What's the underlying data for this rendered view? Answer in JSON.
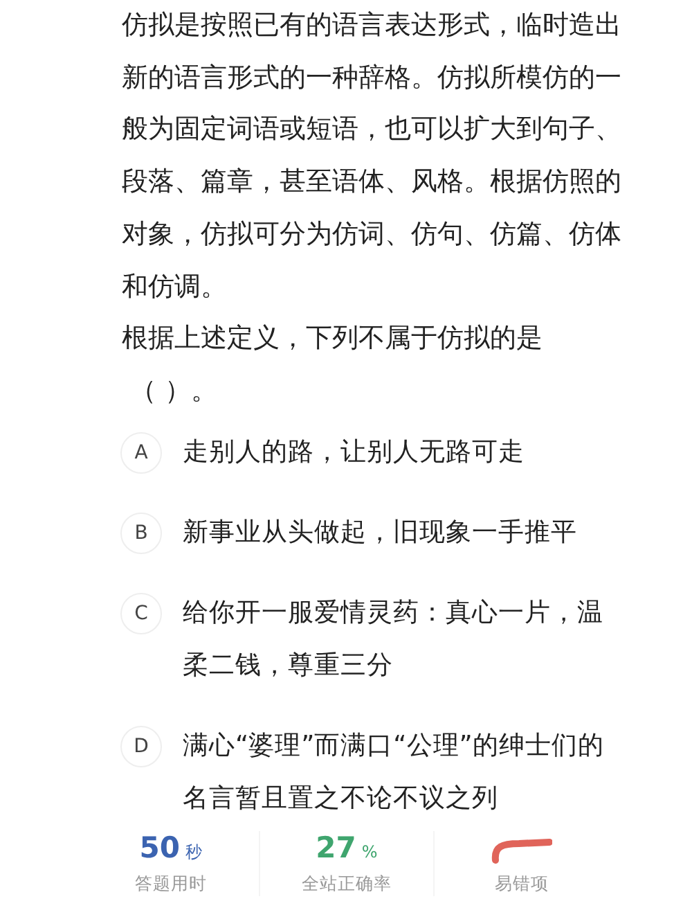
{
  "passage": "仿拟是按照已有的语言表达形式，临时造出新的语言形式的一种辞格。仿拟所模仿的一般为固定词语或短语，也可以扩大到句子、段落、篇章，甚至语体、风格。根据仿照的对象，仿拟可分为仿词、仿句、仿篇、仿体和仿调。",
  "question": "根据上述定义，下列不属于仿拟的是",
  "blank": "（ ）。",
  "options": [
    {
      "letter": "A",
      "text": "走别人的路，让别人无路可走"
    },
    {
      "letter": "B",
      "text": "新事业从头做起，旧现象一手推平"
    },
    {
      "letter": "C",
      "text": "给你开一服爱情灵药：真心一片，温柔二钱，尊重三分"
    },
    {
      "letter": "D",
      "text": "满心“婆理”而满口“公理”的绅士们的名言暂且置之不论不议之列"
    }
  ],
  "stats": [
    {
      "kind": "value",
      "value": "50",
      "unit": "秒",
      "label": "答题用时",
      "color": "#3b63b0"
    },
    {
      "kind": "value",
      "value": "27",
      "unit": "%",
      "label": "全站正确率",
      "color": "#3fa56e"
    },
    {
      "kind": "mark",
      "label": "易错项",
      "color": "#e0645a"
    }
  ]
}
